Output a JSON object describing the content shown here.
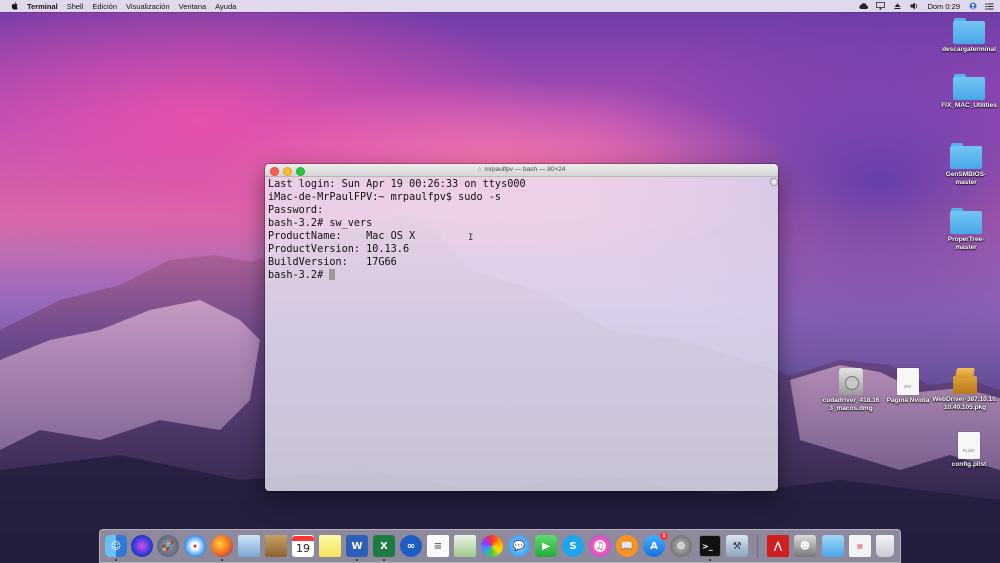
{
  "menubar": {
    "app_name": "Terminal",
    "menus": [
      "Shell",
      "Edición",
      "Visualización",
      "Ventana",
      "Ayuda"
    ],
    "clock": "Dom 0:29",
    "status_icons": [
      "creative-cloud-icon",
      "airplay-icon",
      "eject-icon",
      "volume-icon",
      "user-icon",
      "notification-center-icon"
    ]
  },
  "desktop": {
    "icons": [
      {
        "label": "descargaterminal",
        "kind": "folder"
      },
      {
        "label": "FIX_MAC_Utilities",
        "kind": "folder"
      },
      {
        "label": "GenSMBIOS-master",
        "kind": "folder"
      },
      {
        "label": "ProperTree-master",
        "kind": "folder"
      },
      {
        "label": "cudadriver_418.163_macos.dmg",
        "kind": "dmg"
      },
      {
        "label": "Pagina Nvidia",
        "kind": "document",
        "tag": "RTF"
      },
      {
        "label": "WebDriver-387.10.10.10.40.105.pkg",
        "kind": "package"
      },
      {
        "label": "config.plist",
        "kind": "document",
        "tag": "PLIST"
      }
    ]
  },
  "terminal": {
    "title": "mrpaulfpv — bash — 80×24",
    "lines": [
      "Last login: Sun Apr 19 00:26:33 on ttys000",
      "iMac-de-MrPaulFPV:~ mrpaulfpv$ sudo -s",
      "Password:",
      "bash-3.2# sw_vers",
      "ProductName:\tMac OS X",
      "ProductVersion:\t10.13.6",
      "BuildVersion:\t17G66",
      "bash-3.2# "
    ]
  },
  "dock": {
    "apps": [
      "finder",
      "siri",
      "launchpad",
      "safari",
      "firefox",
      "preview",
      "notes-notebook",
      "calendar",
      "stickies",
      "word",
      "excel",
      "intelligent-app",
      "textedit",
      "photo-booth-scan",
      "photos",
      "messages",
      "facetime",
      "skype",
      "itunes",
      "ibooks",
      "app-store",
      "system-preferences",
      "terminal",
      "xcode-instruments",
      "acrobat",
      "silhouette-app",
      "downloads-stack",
      "documents-stack",
      "trash"
    ],
    "calendar_day": "19",
    "app_store_badge": "1"
  }
}
